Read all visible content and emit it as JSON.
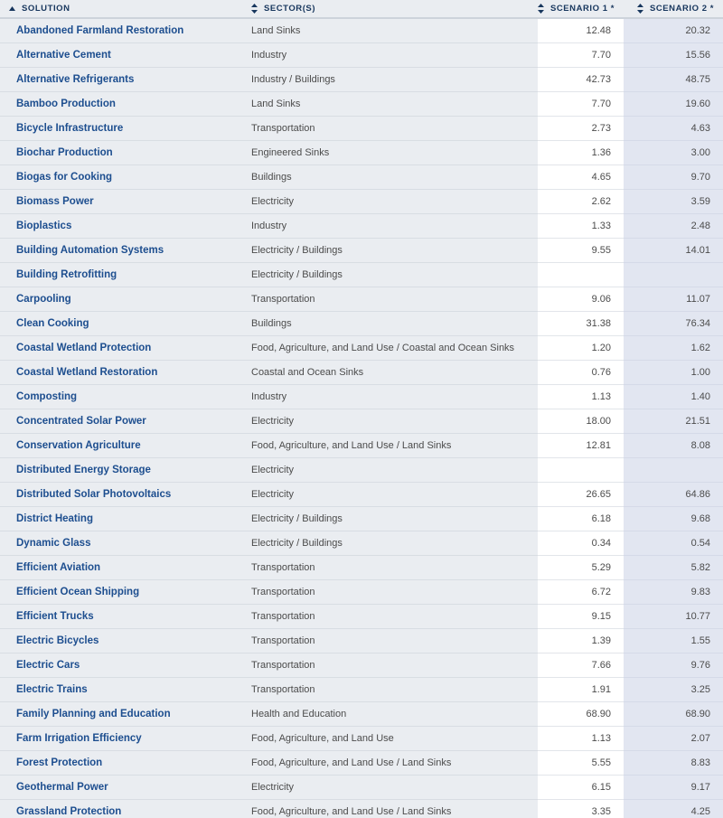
{
  "table": {
    "columns": [
      {
        "key": "solution",
        "label": "SOLUTION",
        "align": "left",
        "sort_icon": "sort-asc-icon",
        "sorted": "asc"
      },
      {
        "key": "sector",
        "label": "SECTOR(S)",
        "align": "left",
        "sort_icon": "sort-both-icon",
        "sorted": "none"
      },
      {
        "key": "s1",
        "label": "SCENARIO 1 *",
        "align": "right",
        "sort_icon": "sort-both-icon",
        "sorted": "none"
      },
      {
        "key": "s2",
        "label": "SCENARIO 2 *",
        "align": "right",
        "sort_icon": "sort-both-icon",
        "sorted": "none"
      }
    ],
    "colors": {
      "header_bg": "#eaedf1",
      "row_bg": "#eaedf1",
      "scenario1_bg": "#ffffff",
      "scenario2_bg": "#e2e6f1",
      "link": "#1d4e8f",
      "text": "#4b4b4b",
      "header_text": "#17365d"
    },
    "rows": [
      {
        "solution": "Abandoned Farmland Restoration",
        "sector": "Land Sinks",
        "s1": "12.48",
        "s2": "20.32"
      },
      {
        "solution": "Alternative Cement",
        "sector": "Industry",
        "s1": "7.70",
        "s2": "15.56"
      },
      {
        "solution": "Alternative Refrigerants",
        "sector": "Industry / Buildings",
        "s1": "42.73",
        "s2": "48.75"
      },
      {
        "solution": "Bamboo Production",
        "sector": "Land Sinks",
        "s1": "7.70",
        "s2": "19.60"
      },
      {
        "solution": "Bicycle Infrastructure",
        "sector": "Transportation",
        "s1": "2.73",
        "s2": "4.63"
      },
      {
        "solution": "Biochar Production",
        "sector": "Engineered Sinks",
        "s1": "1.36",
        "s2": "3.00"
      },
      {
        "solution": "Biogas for Cooking",
        "sector": "Buildings",
        "s1": "4.65",
        "s2": "9.70"
      },
      {
        "solution": "Biomass Power",
        "sector": "Electricity",
        "s1": "2.62",
        "s2": "3.59"
      },
      {
        "solution": "Bioplastics",
        "sector": "Industry",
        "s1": "1.33",
        "s2": "2.48"
      },
      {
        "solution": "Building Automation Systems",
        "sector": "Electricity / Buildings",
        "s1": "9.55",
        "s2": "14.01"
      },
      {
        "solution": "Building Retrofitting",
        "sector": "Electricity / Buildings",
        "s1": "",
        "s2": ""
      },
      {
        "solution": "Carpooling",
        "sector": "Transportation",
        "s1": "9.06",
        "s2": "11.07"
      },
      {
        "solution": "Clean Cooking",
        "sector": "Buildings",
        "s1": "31.38",
        "s2": "76.34"
      },
      {
        "solution": "Coastal Wetland Protection",
        "sector": "Food, Agriculture, and Land Use / Coastal and Ocean Sinks",
        "s1": "1.20",
        "s2": "1.62"
      },
      {
        "solution": "Coastal Wetland Restoration",
        "sector": "Coastal and Ocean Sinks",
        "s1": "0.76",
        "s2": "1.00"
      },
      {
        "solution": "Composting",
        "sector": "Industry",
        "s1": "1.13",
        "s2": "1.40"
      },
      {
        "solution": "Concentrated Solar Power",
        "sector": "Electricity",
        "s1": "18.00",
        "s2": "21.51"
      },
      {
        "solution": "Conservation Agriculture",
        "sector": "Food, Agriculture, and Land Use / Land Sinks",
        "s1": "12.81",
        "s2": "8.08"
      },
      {
        "solution": "Distributed Energy Storage",
        "sector": "Electricity",
        "s1": "",
        "s2": ""
      },
      {
        "solution": "Distributed Solar Photovoltaics",
        "sector": "Electricity",
        "s1": "26.65",
        "s2": "64.86"
      },
      {
        "solution": "District Heating",
        "sector": "Electricity / Buildings",
        "s1": "6.18",
        "s2": "9.68"
      },
      {
        "solution": "Dynamic Glass",
        "sector": "Electricity / Buildings",
        "s1": "0.34",
        "s2": "0.54"
      },
      {
        "solution": "Efficient Aviation",
        "sector": "Transportation",
        "s1": "5.29",
        "s2": "5.82"
      },
      {
        "solution": "Efficient Ocean Shipping",
        "sector": "Transportation",
        "s1": "6.72",
        "s2": "9.83"
      },
      {
        "solution": "Efficient Trucks",
        "sector": "Transportation",
        "s1": "9.15",
        "s2": "10.77"
      },
      {
        "solution": "Electric Bicycles",
        "sector": "Transportation",
        "s1": "1.39",
        "s2": "1.55"
      },
      {
        "solution": "Electric Cars",
        "sector": "Transportation",
        "s1": "7.66",
        "s2": "9.76"
      },
      {
        "solution": "Electric Trains",
        "sector": "Transportation",
        "s1": "1.91",
        "s2": "3.25"
      },
      {
        "solution": "Family Planning and Education",
        "sector": "Health and Education",
        "s1": "68.90",
        "s2": "68.90"
      },
      {
        "solution": "Farm Irrigation Efficiency",
        "sector": "Food, Agriculture, and Land Use",
        "s1": "1.13",
        "s2": "2.07"
      },
      {
        "solution": "Forest Protection",
        "sector": "Food, Agriculture, and Land Use / Land Sinks",
        "s1": "5.55",
        "s2": "8.83"
      },
      {
        "solution": "Geothermal Power",
        "sector": "Electricity",
        "s1": "6.15",
        "s2": "9.17"
      },
      {
        "solution": "Grassland Protection",
        "sector": "Food, Agriculture, and Land Use / Land Sinks",
        "s1": "3.35",
        "s2": "4.25"
      }
    ]
  }
}
